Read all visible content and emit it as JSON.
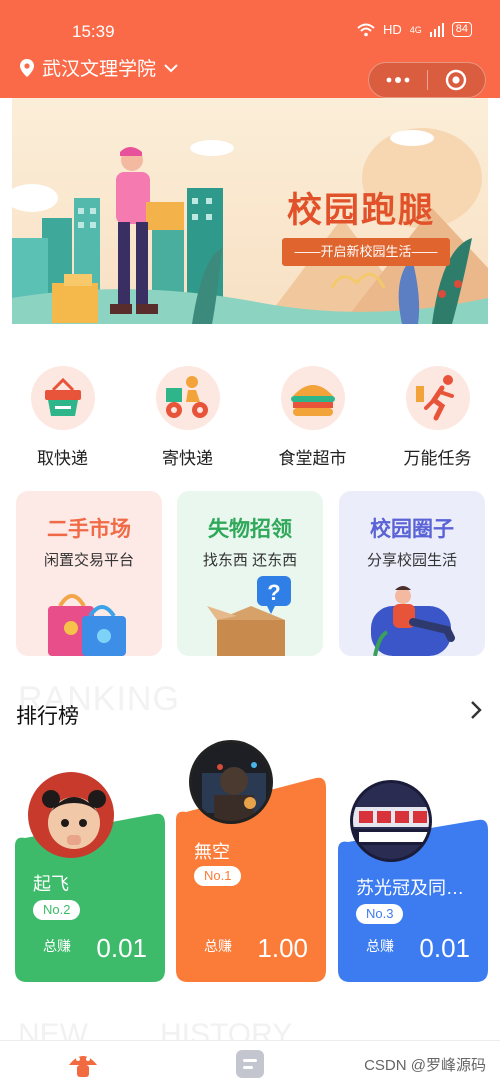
{
  "status": {
    "time": "15:39",
    "network": "HD",
    "signal": "4G",
    "battery": "84"
  },
  "header": {
    "location": "武汉文理学院",
    "more_icon": "more-dots-icon",
    "close_icon": "target-icon"
  },
  "banner": {
    "title": "校园跑腿",
    "subtitle": "——开启新校园生活——"
  },
  "quick_actions": [
    {
      "label": "取快递",
      "icon": "basket-icon"
    },
    {
      "label": "寄快递",
      "icon": "delivery-bike-icon"
    },
    {
      "label": "食堂超市",
      "icon": "burger-icon"
    },
    {
      "label": "万能任务",
      "icon": "running-man-icon"
    }
  ],
  "categories": [
    {
      "title": "二手市场",
      "subtitle": "闲置交易平台",
      "title_color": "#f06a45"
    },
    {
      "title": "失物招领",
      "subtitle": "找东西 还东西",
      "title_color": "#2fa85a"
    },
    {
      "title": "校园圈子",
      "subtitle": "分享校园生活",
      "title_color": "#5a63d6"
    }
  ],
  "ranking": {
    "ghost": "RANKING",
    "title": "排行榜",
    "earn_label": "总赚",
    "entries": [
      {
        "name": "起飞",
        "rank": "No.2",
        "earned": "0.01",
        "color": "#3dbb6a"
      },
      {
        "name": "無空",
        "rank": "No.1",
        "earned": "1.00",
        "color": "#fb7b38"
      },
      {
        "name": "苏光冠及同…",
        "rank": "No.3",
        "earned": "0.01",
        "color": "#3d7cf0"
      }
    ]
  },
  "footer": {
    "ghost_left": "NEW",
    "ghost_right": "HISTORY",
    "watermark": "CSDN @罗峰源码"
  }
}
